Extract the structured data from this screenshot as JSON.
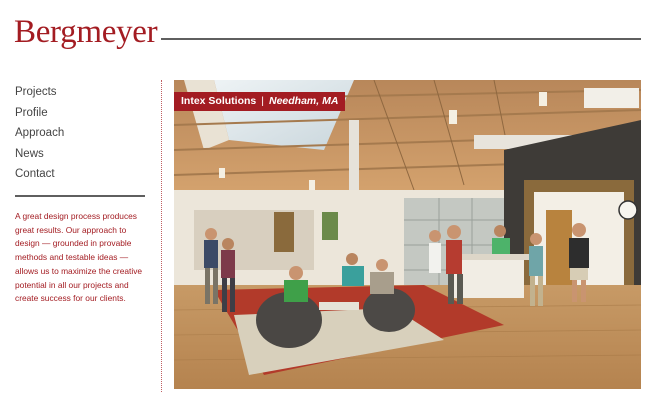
{
  "site": {
    "logo": "Bergmeyer"
  },
  "nav": {
    "items": [
      {
        "label": "Projects"
      },
      {
        "label": "Profile"
      },
      {
        "label": "Approach"
      },
      {
        "label": "News"
      },
      {
        "label": "Contact"
      }
    ]
  },
  "blurb": {
    "text": "A great design process produces great results. Our approach to design — grounded in provable methods and testable ideas — allows us to maximize the creative potential in all our projects and create success for our clients."
  },
  "feature": {
    "project_name": "Intex Solutions",
    "separator": "|",
    "location": "Needham, MA"
  },
  "colors": {
    "brand": "#a31c22",
    "rule": "#5f5f5f",
    "nav_text": "#444444"
  }
}
